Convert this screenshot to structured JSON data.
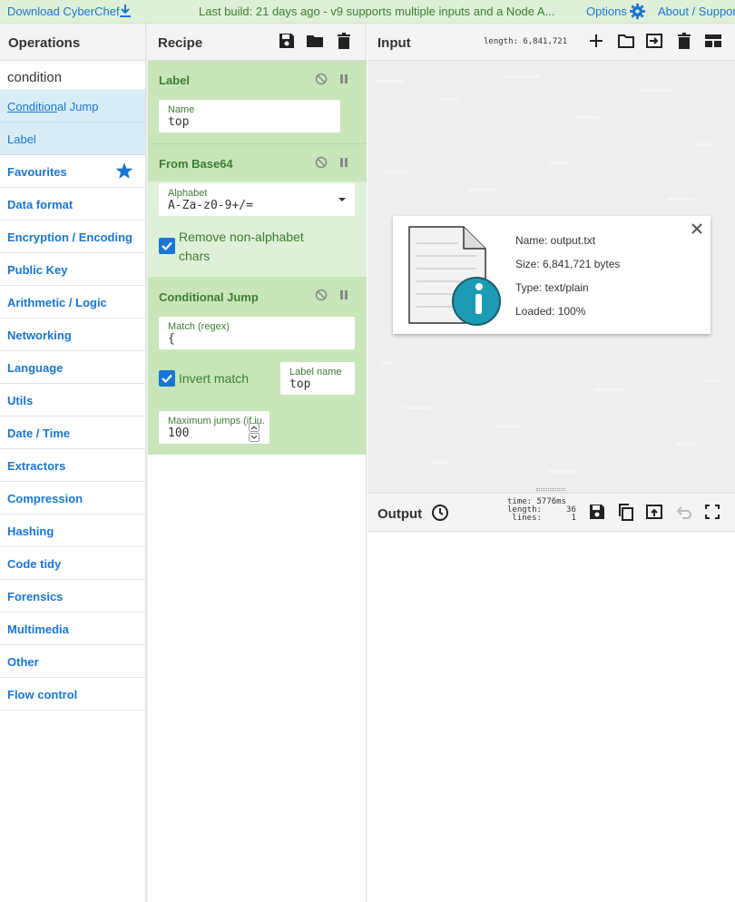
{
  "topbar": {
    "download_label": "Download CyberChef",
    "build_message": "Last build: 21 days ago - v9 supports multiple inputs and a Node A...",
    "options_label": "Options",
    "about_label": "About / Support"
  },
  "operations": {
    "title": "Operations",
    "search_value": "condition",
    "results": [
      {
        "match": "Condition",
        "rest": "al Jump"
      },
      {
        "match": "",
        "rest": "Label"
      }
    ],
    "categories": [
      "Favourites",
      "Data format",
      "Encryption / Encoding",
      "Public Key",
      "Arithmetic / Logic",
      "Networking",
      "Language",
      "Utils",
      "Date / Time",
      "Extractors",
      "Compression",
      "Hashing",
      "Code tidy",
      "Forensics",
      "Multimedia",
      "Other",
      "Flow control"
    ]
  },
  "recipe": {
    "title": "Recipe",
    "steps": [
      {
        "title": "Label",
        "fields": [
          {
            "label": "Name",
            "value": "top"
          }
        ]
      },
      {
        "title": "From Base64",
        "fields": [
          {
            "label": "Alphabet",
            "value": "A-Za-z0-9+/="
          }
        ],
        "checkbox": {
          "label": "Remove non-alphabet chars",
          "checked": true
        }
      },
      {
        "title": "Conditional Jump",
        "fields": [
          {
            "label": "Match (regex)",
            "value": "{"
          },
          {
            "label": "Label name",
            "value": "top"
          },
          {
            "label": "Maximum jumps (if ju...",
            "value": "100"
          }
        ],
        "checkbox": {
          "label": "Invert match",
          "checked": true
        }
      }
    ]
  },
  "input": {
    "title": "Input",
    "length_label": "length: 6,841,721",
    "file": {
      "name": "Name: output.txt",
      "size": "Size: 6,841,721 bytes",
      "type": "Type: text/plain",
      "loaded": "Loaded: 100%"
    }
  },
  "output": {
    "title": "Output",
    "stats": "time: 5776ms\nlength:     36\n lines:      1"
  },
  "colors": {
    "accent": "#1976d2",
    "topbar_bg": "#dff0d8",
    "step_bg": "#c8e6b9",
    "step_text": "#3c7d33",
    "selected_bg": "#d9edf7"
  }
}
